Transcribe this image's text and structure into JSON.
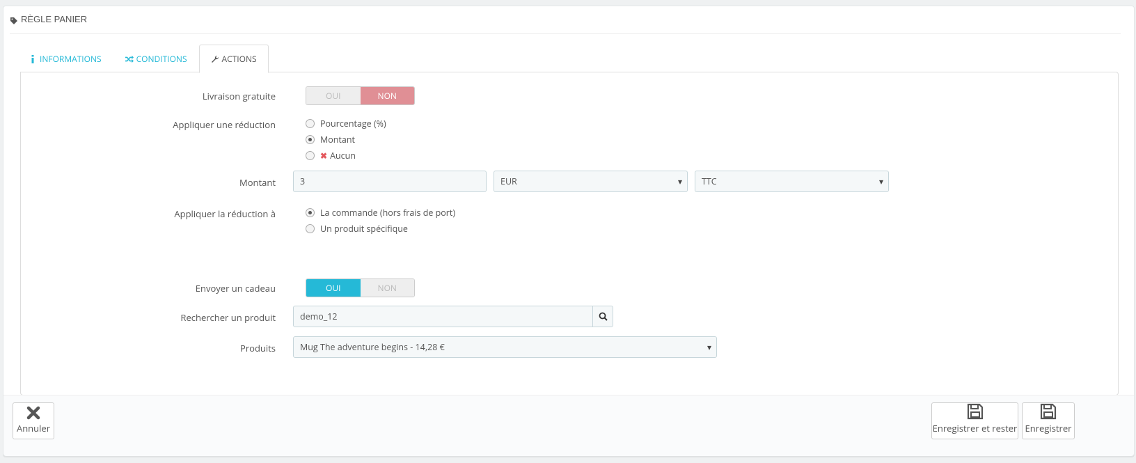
{
  "panel": {
    "title": "RÈGLE PANIER",
    "title_icon": "tag-icon"
  },
  "tabs": [
    {
      "label": "INFORMATIONS",
      "icon": "info-icon"
    },
    {
      "label": "CONDITIONS",
      "icon": "shuffle-icon"
    },
    {
      "label": "ACTIONS",
      "icon": "wrench-icon",
      "active": true
    }
  ],
  "form": {
    "free_shipping": {
      "label": "Livraison gratuite",
      "yes": "OUI",
      "no": "NON",
      "selected": "NON"
    },
    "apply_discount": {
      "label": "Appliquer une réduction",
      "options": [
        "Pourcentage (%)",
        "Montant",
        "Aucun"
      ],
      "selected": "Montant"
    },
    "amount": {
      "label": "Montant",
      "value": "3",
      "currency": "EUR",
      "tax": "TTC"
    },
    "apply_to": {
      "label": "Appliquer la réduction à",
      "options": [
        "La commande (hors frais de port)",
        "Un produit spécifique"
      ],
      "selected": "La commande (hors frais de port)"
    },
    "send_gift": {
      "label": "Envoyer un cadeau",
      "yes": "OUI",
      "no": "NON",
      "selected": "OUI"
    },
    "search_product": {
      "label": "Rechercher un produit",
      "value": "demo_12"
    },
    "products": {
      "label": "Produits",
      "value": "Mug The adventure begins - 14,28 €"
    }
  },
  "footer": {
    "cancel": "Annuler",
    "save_stay": "Enregistrer et rester",
    "save": "Enregistrer"
  },
  "colors": {
    "accent": "#25b9d7",
    "danger_soft": "#e08f95",
    "danger": "#e4585d"
  }
}
